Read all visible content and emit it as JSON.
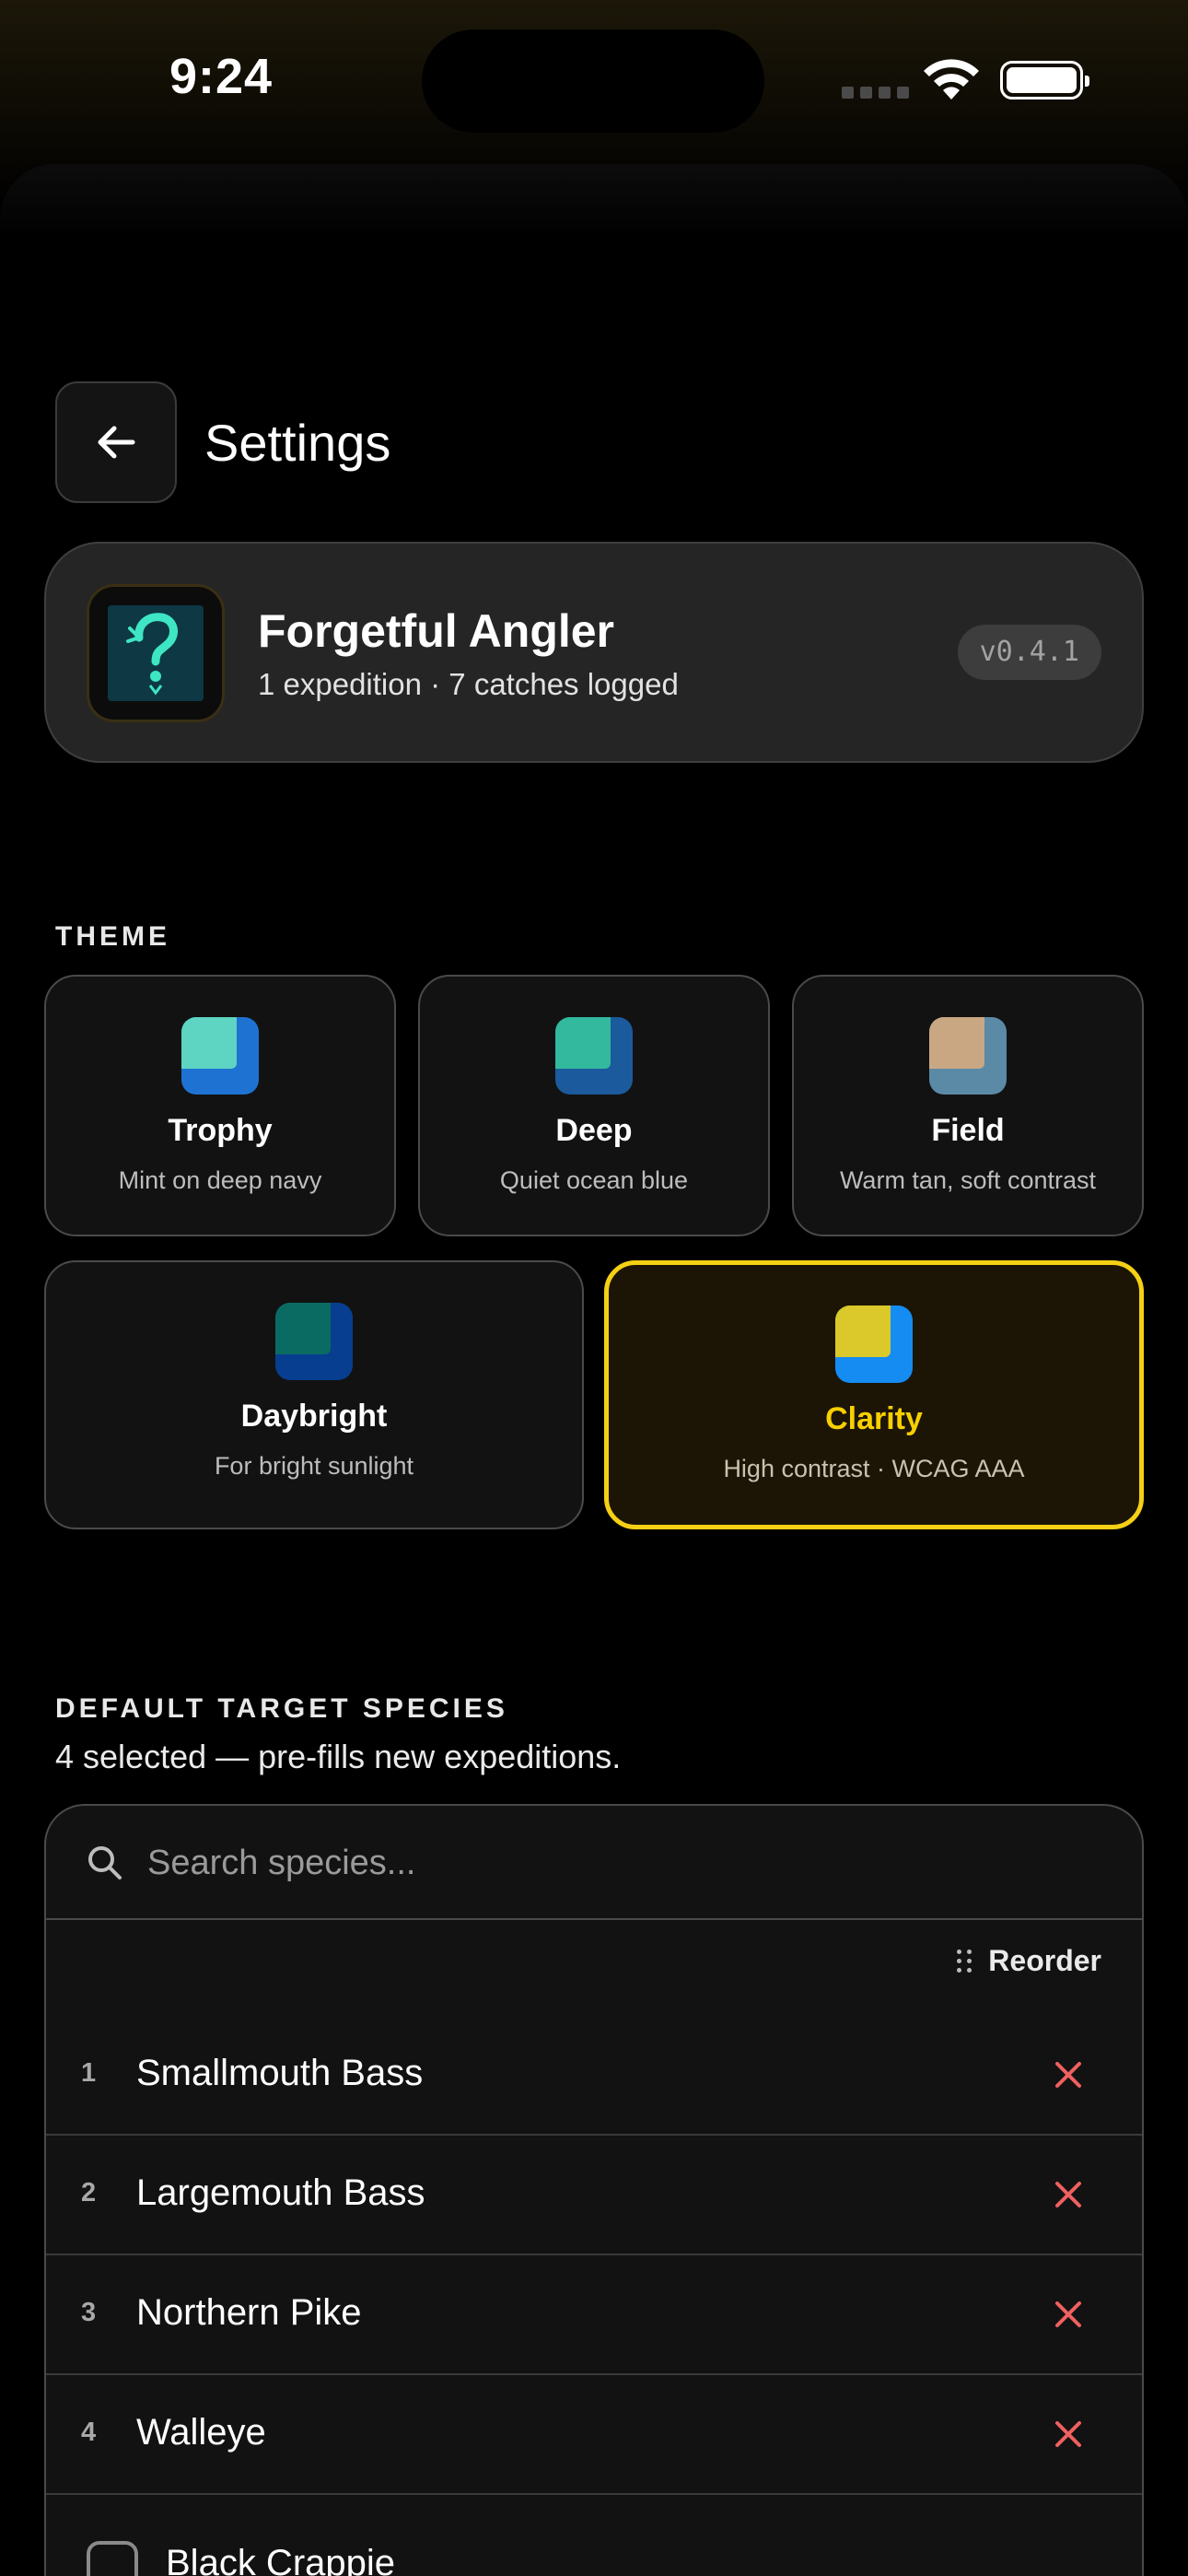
{
  "status_bar": {
    "time": "9:24"
  },
  "header": {
    "title": "Settings",
    "back_icon": "arrow-left-icon"
  },
  "profile": {
    "name": "Forgetful Angler",
    "stats": "1 expedition · 7 catches logged",
    "version": "v0.4.1",
    "icon": "angler-hook-icon"
  },
  "theme": {
    "label": "THEME",
    "options": [
      {
        "name": "Trophy",
        "desc": "Mint on deep navy",
        "colors": [
          "#5ed4c2",
          "#1e73d2"
        ],
        "selected": false
      },
      {
        "name": "Deep",
        "desc": "Quiet ocean blue",
        "colors": [
          "#32b99e",
          "#1b5a9c"
        ],
        "selected": false
      },
      {
        "name": "Field",
        "desc": "Warm tan, soft contrast",
        "colors": [
          "#caa783",
          "#5a8aa6"
        ],
        "selected": false
      },
      {
        "name": "Daybright",
        "desc": "For bright sunlight",
        "colors": [
          "#0a6b63",
          "#073e8f"
        ],
        "selected": false
      },
      {
        "name": "Clarity",
        "desc": "High contrast · WCAG AAA",
        "colors": [
          "#dbc82a",
          "#148cf2"
        ],
        "selected": true
      }
    ],
    "accent": "#f5d014"
  },
  "species": {
    "label": "DEFAULT TARGET SPECIES",
    "desc": "4 selected — pre-fills new expeditions.",
    "search_placeholder": "Search species...",
    "reorder_label": "Reorder",
    "selected": [
      {
        "num": "1",
        "name": "Smallmouth Bass"
      },
      {
        "num": "2",
        "name": "Largemouth Bass"
      },
      {
        "num": "3",
        "name": "Northern Pike"
      },
      {
        "num": "4",
        "name": "Walleye"
      }
    ],
    "options": [
      {
        "name": "Black Crappie",
        "checked": false
      }
    ],
    "remove_color": "#f06060"
  }
}
